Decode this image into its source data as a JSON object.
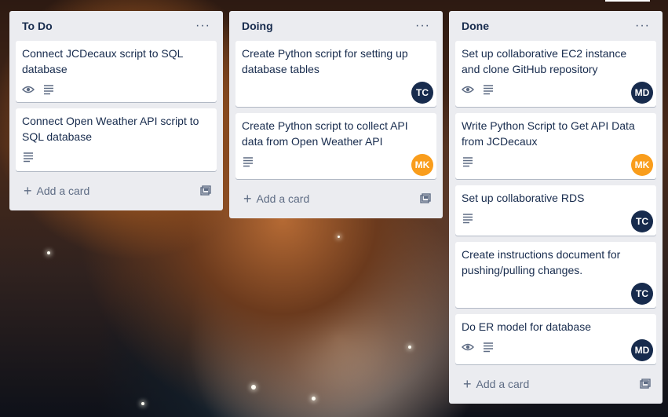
{
  "board": {
    "lists": [
      {
        "title": "To Do",
        "menu": "···",
        "add_card": "Add a card",
        "cards": [
          {
            "title": "Connect JCDecaux script to SQL database"
          },
          {
            "title": "Connect Open Weather API script to SQL database"
          }
        ]
      },
      {
        "title": "Doing",
        "menu": "···",
        "add_card": "Add a card",
        "cards": [
          {
            "title": "Create Python script for setting up database tables",
            "avatar": "TC"
          },
          {
            "title": "Create Python script to collect API data from Open Weather API",
            "avatar": "MK"
          }
        ]
      },
      {
        "title": "Done",
        "menu": "···",
        "add_card": "Add a card",
        "cards": [
          {
            "title": "Set up collaborative EC2 instance and clone GitHub repository",
            "avatar": "MD"
          },
          {
            "title": "Write Python Script to Get API Data from JCDecaux",
            "avatar": "MK"
          },
          {
            "title": "Set up collaborative RDS",
            "avatar": "TC"
          },
          {
            "title": "Create instructions document for pushing/pulling changes.",
            "avatar": "TC"
          },
          {
            "title": "Do ER model for database",
            "avatar": "MD"
          }
        ]
      }
    ]
  },
  "colors": {
    "list_bg": "#ebecf0",
    "avatar_tc": "#172b4d",
    "avatar_md": "#172b4d",
    "avatar_mk": "#f99d1c"
  },
  "icons": {
    "watch": "eye-icon",
    "description": "description-icon",
    "template": "card-template-icon",
    "add": "plus-icon",
    "menu": "more-horizontal-icon"
  }
}
